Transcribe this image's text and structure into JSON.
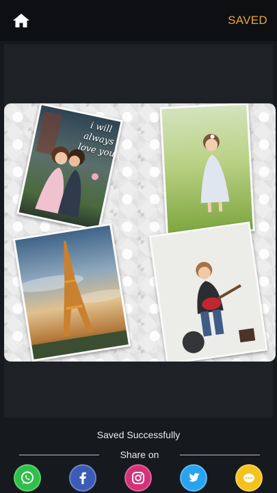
{
  "toolbar": {
    "home_icon": "home-icon",
    "saved_label": "SAVED",
    "accent_color": "#f2a33a"
  },
  "collage": {
    "photo_caption": "i will always love you"
  },
  "status": {
    "message": "Saved Successfully",
    "share_label": "Share on"
  },
  "share_targets": [
    {
      "icon": "whatsapp-icon",
      "color": "#2fbf4a"
    },
    {
      "icon": "facebook-icon",
      "color": "#3b5bb5"
    },
    {
      "icon": "instagram-icon",
      "color": "#d3317a"
    },
    {
      "icon": "twitter-icon",
      "color": "#2aa3ef"
    },
    {
      "icon": "more-icon",
      "color": "#f4c21c"
    }
  ]
}
